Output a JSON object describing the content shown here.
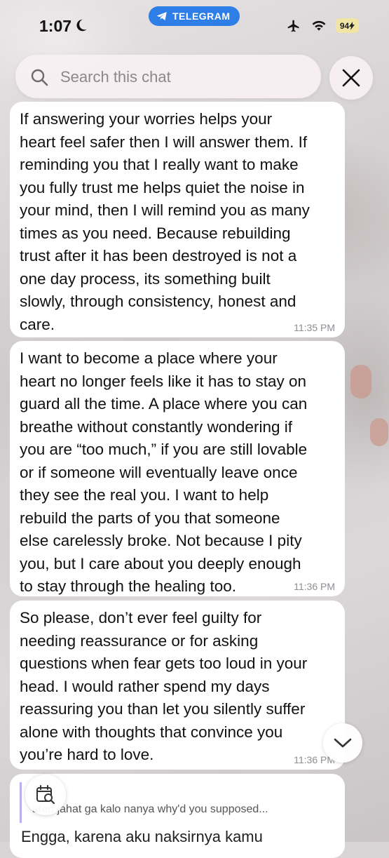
{
  "status_bar": {
    "time": "1:07",
    "app_pill": "TELEGRAM",
    "battery": "94"
  },
  "search": {
    "placeholder": "Search this chat"
  },
  "messages": [
    {
      "text": "If answering your worries helps your\nheart feel safer then I will answer them. If\nreminding you that I really want to make\nyou fully trust me helps quiet the noise in\nyour mind, then I will remind you as many\ntimes as you need. Because rebuilding\ntrust after it has been destroyed is not a\none day process, its something built\nslowly, through consistency, honest and\ncare.",
      "time": "11:35 PM"
    },
    {
      "text": "I want to become a place where your\nheart no longer feels like it has to stay on\nguard all the time. A place where you can\nbreathe without constantly wondering if\nyou are “too much,” if you are still lovable\nor if someone will eventually leave once\nthey see the real you. I want to help\nrebuild the parts of you that someone\nelse carelessly broke. Not because I pity\nyou, but I care about you deeply enough\nto stay through the healing too.",
      "time": "11:36 PM"
    },
    {
      "text": "So please, don’t ever feel guilty for\nneeding reassurance or for asking\nquestions when fear gets too loud in your\nhead. I would rather spend my days\nreassuring you than let you silently suffer\nalone with thoughts that convince you\nyou’re hard to love.",
      "time": "11:36 PM"
    }
  ],
  "partial_message": {
    "reply_quote": "ateu jahat ga kalo nanya why'd you supposed...",
    "text": "Engga, karena aku naksirnya kamu"
  },
  "icons": {
    "moon": "moon-icon",
    "telegram": "telegram-icon",
    "airplane": "airplane-mode-icon",
    "wifi": "wifi-icon",
    "search": "search-icon",
    "close": "close-icon",
    "scroll_down": "chevron-down-icon",
    "calendar": "calendar-search-icon"
  },
  "colors": {
    "accent": "#2d7ee6",
    "bubble": "#ffffff",
    "timestamp": "#8e8e93",
    "battery_low_power": "#f0e5a5"
  }
}
